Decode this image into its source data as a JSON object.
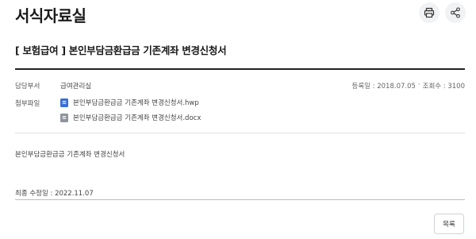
{
  "page": {
    "title": "서식자료실"
  },
  "toolbar": {
    "print_icon": "printer-icon",
    "share_icon": "share-icon"
  },
  "document": {
    "title": "[ 보험급여 ] 본인부담금환급금 기존계좌 변경신청서",
    "department_label": "담당부서",
    "department_value": "급여관리실",
    "registered": "등록일 : 2018.07.05",
    "separator": "·",
    "views": "조회수 : 3100",
    "attachments_label": "첨부파일",
    "attachments": [
      {
        "icon": "hwp-file-icon",
        "icon_glyph": "≡",
        "name": "본인부담금환급금 기존계좌 변경신청서.hwp"
      },
      {
        "icon": "docx-file-icon",
        "icon_glyph": "≡",
        "name": "본인부담금환급금 기존계좌 변경신청서.docx"
      }
    ],
    "content": "본인부담금환급금 기존계좌 변경신청서",
    "last_modified": "최종 수정일 : 2022.11.07"
  },
  "footer": {
    "list_button": "목록"
  },
  "colors": {
    "hwp_icon": "#3a6fd8",
    "docx_icon": "#8f939c",
    "title_rule": "#222222"
  }
}
